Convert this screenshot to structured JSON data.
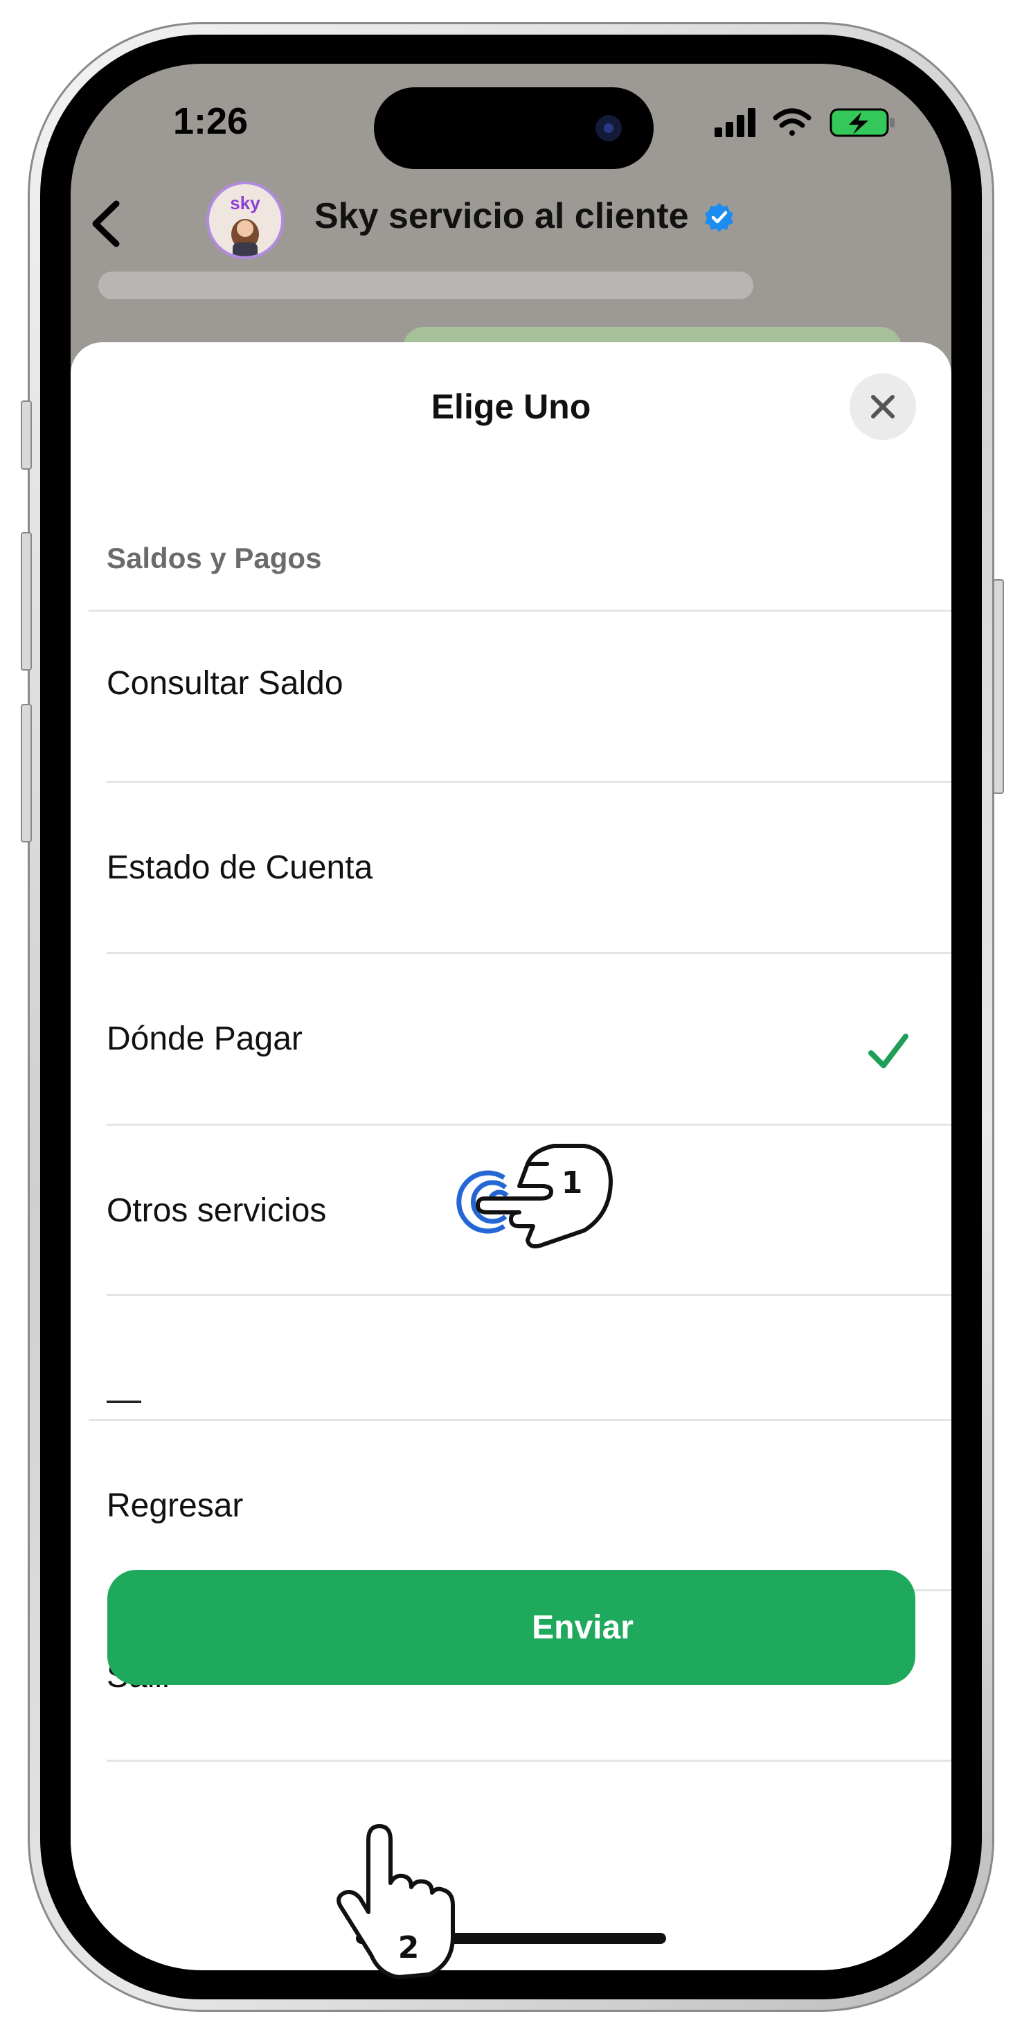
{
  "status_bar": {
    "time": "1:26"
  },
  "chat_header": {
    "contact_name": "Sky servicio al cliente",
    "avatar_text": "sky"
  },
  "sheet": {
    "title": "Elige Uno",
    "section_label": "Saldos y Pagos",
    "items": [
      {
        "label": "Consultar Saldo",
        "selected": false
      },
      {
        "label": "Estado de Cuenta",
        "selected": false
      },
      {
        "label": "Dónde Pagar",
        "selected": false
      },
      {
        "label": "Otros servicios",
        "selected": true
      }
    ],
    "separator_label": "—",
    "extra_items": [
      {
        "label": "Regresar"
      },
      {
        "label": "Salir"
      }
    ],
    "send_label": "Enviar"
  },
  "annotations": {
    "step1": "1",
    "step2": "2"
  },
  "colors": {
    "accent_green": "#1ea95d",
    "check_green": "#1f9e57",
    "verified_blue": "#1d8cf0"
  }
}
